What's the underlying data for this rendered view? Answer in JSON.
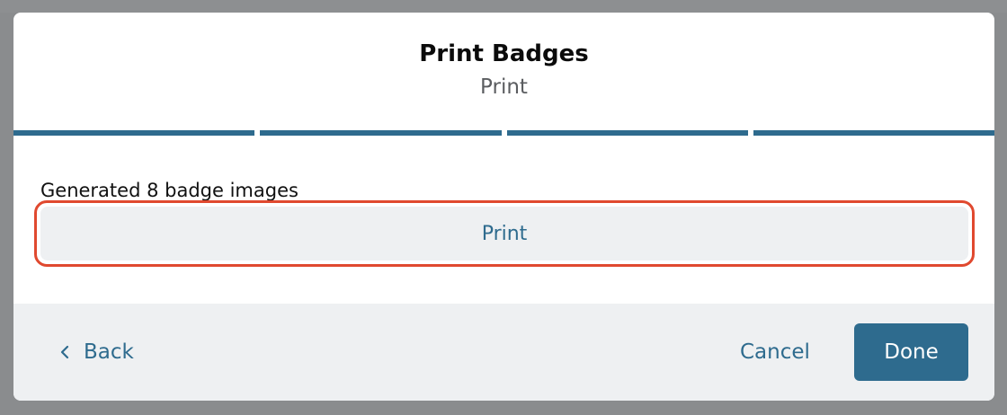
{
  "modal": {
    "title": "Print Badges",
    "subtitle": "Print",
    "steps": 4
  },
  "body": {
    "status_text": "Generated 8 badge images",
    "print_label": "Print"
  },
  "footer": {
    "back_label": "Back",
    "cancel_label": "Cancel",
    "done_label": "Done"
  },
  "colors": {
    "accent": "#2e6b8e",
    "highlight_border": "#e0492f",
    "footer_bg": "#eef0f2"
  },
  "icons": {
    "back": "chevron-left-icon"
  }
}
